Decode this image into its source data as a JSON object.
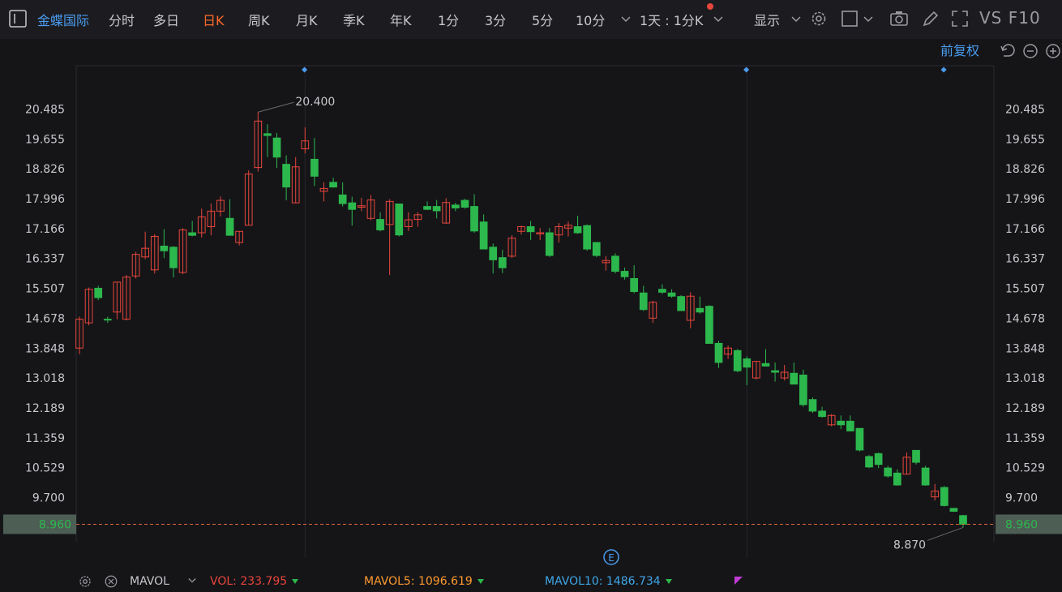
{
  "toolbar": {
    "stock_name": "金蝶国际",
    "periods": [
      "分时",
      "多日",
      "日K",
      "周K",
      "月K",
      "季K",
      "年K",
      "1分",
      "3分",
      "5分",
      "10分"
    ],
    "active_period": "日K",
    "range_label": "1天 : 1分K",
    "display_label": "显示",
    "vs_label": "VS F10"
  },
  "adjust_label": "前复权",
  "colors": {
    "background": "#151518",
    "up": "#e8463c",
    "down": "#2db84d",
    "current_price_line": "#d9673a",
    "blue_accent": "#4a9cf0",
    "current_price_box": "#4d5e55"
  },
  "chart_data": {
    "type": "candlestick",
    "y_ticks": [
      "20.485",
      "19.655",
      "18.826",
      "17.996",
      "17.166",
      "16.337",
      "15.507",
      "14.678",
      "13.848",
      "13.018",
      "12.189",
      "11.359",
      "10.529",
      "9.700"
    ],
    "ylim": [
      8.7,
      20.9
    ],
    "current_price": "8.960",
    "high_annotation": "20.400",
    "low_annotation": "8.870",
    "candles": [
      {
        "o": 13.85,
        "h": 14.72,
        "l": 13.68,
        "c": 14.65
      },
      {
        "o": 14.55,
        "h": 15.53,
        "l": 14.48,
        "c": 15.48
      },
      {
        "o": 15.51,
        "h": 15.58,
        "l": 15.18,
        "c": 15.25
      },
      {
        "o": 14.65,
        "h": 14.72,
        "l": 14.55,
        "c": 14.63
      },
      {
        "o": 14.85,
        "h": 15.68,
        "l": 14.65,
        "c": 15.68
      },
      {
        "o": 14.65,
        "h": 15.88,
        "l": 14.62,
        "c": 15.82
      },
      {
        "o": 15.85,
        "h": 16.52,
        "l": 15.78,
        "c": 16.45
      },
      {
        "o": 16.38,
        "h": 17.08,
        "l": 16.32,
        "c": 16.62
      },
      {
        "o": 16.02,
        "h": 17.01,
        "l": 15.92,
        "c": 16.95
      },
      {
        "o": 16.68,
        "h": 17.15,
        "l": 16.35,
        "c": 16.55
      },
      {
        "o": 16.65,
        "h": 16.68,
        "l": 15.81,
        "c": 16.08
      },
      {
        "o": 15.95,
        "h": 17.18,
        "l": 15.9,
        "c": 17.13
      },
      {
        "o": 17.05,
        "h": 17.38,
        "l": 16.95,
        "c": 16.98
      },
      {
        "o": 17.05,
        "h": 17.72,
        "l": 16.92,
        "c": 17.49
      },
      {
        "o": 17.22,
        "h": 17.86,
        "l": 16.98,
        "c": 17.65
      },
      {
        "o": 17.65,
        "h": 18.06,
        "l": 17.5,
        "c": 17.95
      },
      {
        "o": 17.45,
        "h": 17.98,
        "l": 17.02,
        "c": 16.98
      },
      {
        "o": 16.78,
        "h": 17.09,
        "l": 16.7,
        "c": 17.09
      },
      {
        "o": 17.26,
        "h": 18.78,
        "l": 17.25,
        "c": 18.68
      },
      {
        "o": 18.86,
        "h": 20.4,
        "l": 18.75,
        "c": 20.15
      },
      {
        "o": 19.8,
        "h": 20.06,
        "l": 19.15,
        "c": 19.75
      },
      {
        "o": 19.68,
        "h": 19.82,
        "l": 18.85,
        "c": 19.15
      },
      {
        "o": 18.95,
        "h": 19.2,
        "l": 17.95,
        "c": 18.32
      },
      {
        "o": 17.88,
        "h": 19.15,
        "l": 17.88,
        "c": 18.88
      },
      {
        "o": 19.38,
        "h": 19.98,
        "l": 19.25,
        "c": 19.6
      },
      {
        "o": 19.09,
        "h": 19.68,
        "l": 18.35,
        "c": 18.62
      },
      {
        "o": 18.2,
        "h": 18.45,
        "l": 17.92,
        "c": 18.28
      },
      {
        "o": 18.45,
        "h": 18.58,
        "l": 18.3,
        "c": 18.32
      },
      {
        "o": 18.1,
        "h": 18.45,
        "l": 17.78,
        "c": 17.86
      },
      {
        "o": 17.88,
        "h": 18.05,
        "l": 17.25,
        "c": 17.7
      },
      {
        "o": 17.76,
        "h": 18.02,
        "l": 17.65,
        "c": 17.8
      },
      {
        "o": 17.45,
        "h": 18.1,
        "l": 17.4,
        "c": 17.96
      },
      {
        "o": 17.42,
        "h": 17.62,
        "l": 17.09,
        "c": 17.13
      },
      {
        "o": 17.28,
        "h": 17.98,
        "l": 15.88,
        "c": 17.92
      },
      {
        "o": 17.85,
        "h": 17.86,
        "l": 16.95,
        "c": 16.99
      },
      {
        "o": 17.22,
        "h": 17.62,
        "l": 17.1,
        "c": 17.41
      },
      {
        "o": 17.42,
        "h": 17.62,
        "l": 17.22,
        "c": 17.55
      },
      {
        "o": 17.78,
        "h": 17.92,
        "l": 17.68,
        "c": 17.7
      },
      {
        "o": 17.78,
        "h": 17.96,
        "l": 17.45,
        "c": 17.66
      },
      {
        "o": 17.32,
        "h": 18.01,
        "l": 17.3,
        "c": 17.89
      },
      {
        "o": 17.82,
        "h": 17.88,
        "l": 17.65,
        "c": 17.74
      },
      {
        "o": 17.95,
        "h": 17.99,
        "l": 17.72,
        "c": 17.76
      },
      {
        "o": 17.78,
        "h": 18.12,
        "l": 17.05,
        "c": 17.1
      },
      {
        "o": 17.35,
        "h": 17.56,
        "l": 16.6,
        "c": 16.6
      },
      {
        "o": 16.65,
        "h": 16.75,
        "l": 15.92,
        "c": 16.3
      },
      {
        "o": 16.36,
        "h": 16.58,
        "l": 15.93,
        "c": 16.08
      },
      {
        "o": 16.4,
        "h": 16.98,
        "l": 16.35,
        "c": 16.9
      },
      {
        "o": 17.09,
        "h": 17.25,
        "l": 17.0,
        "c": 17.22
      },
      {
        "o": 17.22,
        "h": 17.38,
        "l": 16.85,
        "c": 17.08
      },
      {
        "o": 17.02,
        "h": 17.18,
        "l": 16.85,
        "c": 17.05
      },
      {
        "o": 17.05,
        "h": 17.18,
        "l": 16.38,
        "c": 16.42
      },
      {
        "o": 16.99,
        "h": 17.32,
        "l": 16.78,
        "c": 17.22
      },
      {
        "o": 17.18,
        "h": 17.36,
        "l": 16.95,
        "c": 17.26
      },
      {
        "o": 17.22,
        "h": 17.52,
        "l": 17.02,
        "c": 17.05
      },
      {
        "o": 17.25,
        "h": 17.28,
        "l": 16.55,
        "c": 16.6
      },
      {
        "o": 16.78,
        "h": 16.78,
        "l": 16.38,
        "c": 16.42
      },
      {
        "o": 16.22,
        "h": 16.4,
        "l": 16.0,
        "c": 16.28
      },
      {
        "o": 16.4,
        "h": 16.48,
        "l": 15.92,
        "c": 15.98
      },
      {
        "o": 15.98,
        "h": 16.08,
        "l": 15.75,
        "c": 15.83
      },
      {
        "o": 15.78,
        "h": 16.15,
        "l": 15.37,
        "c": 15.42
      },
      {
        "o": 15.38,
        "h": 15.58,
        "l": 14.88,
        "c": 14.92
      },
      {
        "o": 14.68,
        "h": 15.16,
        "l": 14.55,
        "c": 15.12
      },
      {
        "o": 15.48,
        "h": 15.62,
        "l": 15.35,
        "c": 15.4
      },
      {
        "o": 15.38,
        "h": 15.48,
        "l": 15.25,
        "c": 15.29
      },
      {
        "o": 15.28,
        "h": 15.32,
        "l": 14.89,
        "c": 14.89
      },
      {
        "o": 14.62,
        "h": 15.4,
        "l": 14.4,
        "c": 15.29
      },
      {
        "o": 14.95,
        "h": 15.28,
        "l": 14.8,
        "c": 14.85
      },
      {
        "o": 15.01,
        "h": 15.04,
        "l": 13.98,
        "c": 13.98
      },
      {
        "o": 13.98,
        "h": 14.05,
        "l": 13.3,
        "c": 13.45
      },
      {
        "o": 13.68,
        "h": 13.92,
        "l": 13.55,
        "c": 13.85
      },
      {
        "o": 13.78,
        "h": 13.82,
        "l": 13.18,
        "c": 13.22
      },
      {
        "o": 13.55,
        "h": 13.62,
        "l": 12.82,
        "c": 13.32
      },
      {
        "o": 13.02,
        "h": 13.48,
        "l": 12.98,
        "c": 13.48
      },
      {
        "o": 13.42,
        "h": 13.82,
        "l": 13.35,
        "c": 13.35
      },
      {
        "o": 13.22,
        "h": 13.45,
        "l": 12.92,
        "c": 13.18
      },
      {
        "o": 13.02,
        "h": 13.38,
        "l": 12.95,
        "c": 13.18
      },
      {
        "o": 13.15,
        "h": 13.45,
        "l": 13.1,
        "c": 12.85
      },
      {
        "o": 13.1,
        "h": 13.25,
        "l": 12.22,
        "c": 12.28
      },
      {
        "o": 12.42,
        "h": 12.48,
        "l": 12.05,
        "c": 12.1
      },
      {
        "o": 12.1,
        "h": 12.22,
        "l": 11.92,
        "c": 11.95
      },
      {
        "o": 11.72,
        "h": 12.02,
        "l": 11.68,
        "c": 11.98
      },
      {
        "o": 11.82,
        "h": 11.98,
        "l": 11.6,
        "c": 11.72
      },
      {
        "o": 11.82,
        "h": 11.98,
        "l": 11.55,
        "c": 11.55
      },
      {
        "o": 11.62,
        "h": 11.62,
        "l": 10.98,
        "c": 11.02
      },
      {
        "o": 10.84,
        "h": 10.88,
        "l": 10.52,
        "c": 10.55
      },
      {
        "o": 10.92,
        "h": 10.95,
        "l": 10.52,
        "c": 10.62
      },
      {
        "o": 10.52,
        "h": 10.58,
        "l": 10.25,
        "c": 10.3
      },
      {
        "o": 10.38,
        "h": 10.48,
        "l": 10.03,
        "c": 10.05
      },
      {
        "o": 10.35,
        "h": 10.95,
        "l": 10.35,
        "c": 10.82
      },
      {
        "o": 11.01,
        "h": 11.01,
        "l": 10.62,
        "c": 10.68
      },
      {
        "o": 10.52,
        "h": 10.58,
        "l": 10.03,
        "c": 10.05
      },
      {
        "o": 9.72,
        "h": 10.08,
        "l": 9.62,
        "c": 9.88
      },
      {
        "o": 9.98,
        "h": 10.02,
        "l": 9.45,
        "c": 9.48
      },
      {
        "o": 9.4,
        "h": 9.4,
        "l": 9.3,
        "c": 9.32
      },
      {
        "o": 9.2,
        "h": 9.22,
        "l": 8.87,
        "c": 8.96
      }
    ],
    "dividers": [
      24,
      71,
      111,
      155,
      208
    ]
  },
  "volume_bar": {
    "mavol_label": "MAVOL",
    "vol_label": "VOL: 233.795",
    "mavol5_label": "MAVOL5: 1096.619",
    "mavol10_label": "MAVOL10: 1486.734",
    "vol_color": "#e8463c",
    "mavol5_color": "#ff9a2e",
    "mavol10_color": "#3fa7e8"
  },
  "event_marker": "E"
}
